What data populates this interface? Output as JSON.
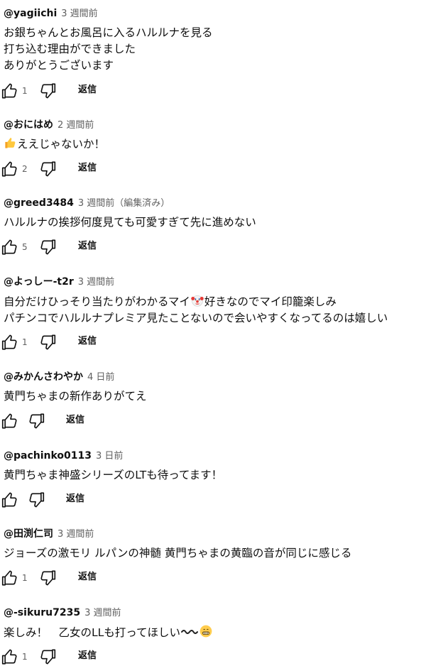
{
  "reply_label": "返信",
  "comments": [
    {
      "author": "@yagiichi",
      "time": "3 週間前",
      "lines": [
        "お銀ちゃんとお風呂に入るハルルナを見る",
        "打ち込む理由ができました",
        "ありがとうございます"
      ],
      "likes": "1"
    },
    {
      "author": "@おにはめ",
      "time": "2 週間前",
      "emoji": "thumbs-up-emoji",
      "lines": [
        "ええじゃないか！"
      ],
      "likes": "2"
    },
    {
      "author": "@greed3484",
      "time": "3 週間前（編集済み）",
      "lines": [
        "ハルルナの挨拶何度見ても可愛すぎて先に進めない"
      ],
      "likes": "5"
    },
    {
      "author": "@よっしー-t2r",
      "time": "3 週間前",
      "line1_a": "自分だけひっそり当たりがわかるマイ",
      "line1_emoji": "clown-face-emoji",
      "line1_b": "好きなのでマイ印籠楽しみ",
      "line2": "パチンコでハルルナプレミア見たことないので会いやすくなってるのは嬉しい",
      "likes": "1"
    },
    {
      "author": "@みかんさわやか",
      "time": "4 日前",
      "lines": [
        "黄門ちゃまの新作ありがてえ"
      ],
      "likes": ""
    },
    {
      "author": "@pachinko0113",
      "time": "3 日前",
      "lines": [
        "黄門ちゃま神盛シリーズのLTも待ってます！"
      ],
      "likes": ""
    },
    {
      "author": "@田渕仁司",
      "time": "3 週間前",
      "lines": [
        "ジョーズの激モリ ルパンの神髄 黄門ちゃまの黄臨の音が同じに感じる"
      ],
      "likes": "1"
    },
    {
      "author": "@-sikuru7235",
      "time": "3 週間前",
      "text_a": "楽しみ！　乙女のLLも打ってほしい",
      "emoji_a": "wavy-dash",
      "emoji_b": "grinning-face-emoji",
      "likes": "1"
    }
  ],
  "icons": {
    "like": "thumbs-up-outline-icon",
    "dislike": "thumbs-down-outline-icon"
  },
  "colors": {
    "text": "#0f0f0f",
    "secondary": "#606060"
  }
}
